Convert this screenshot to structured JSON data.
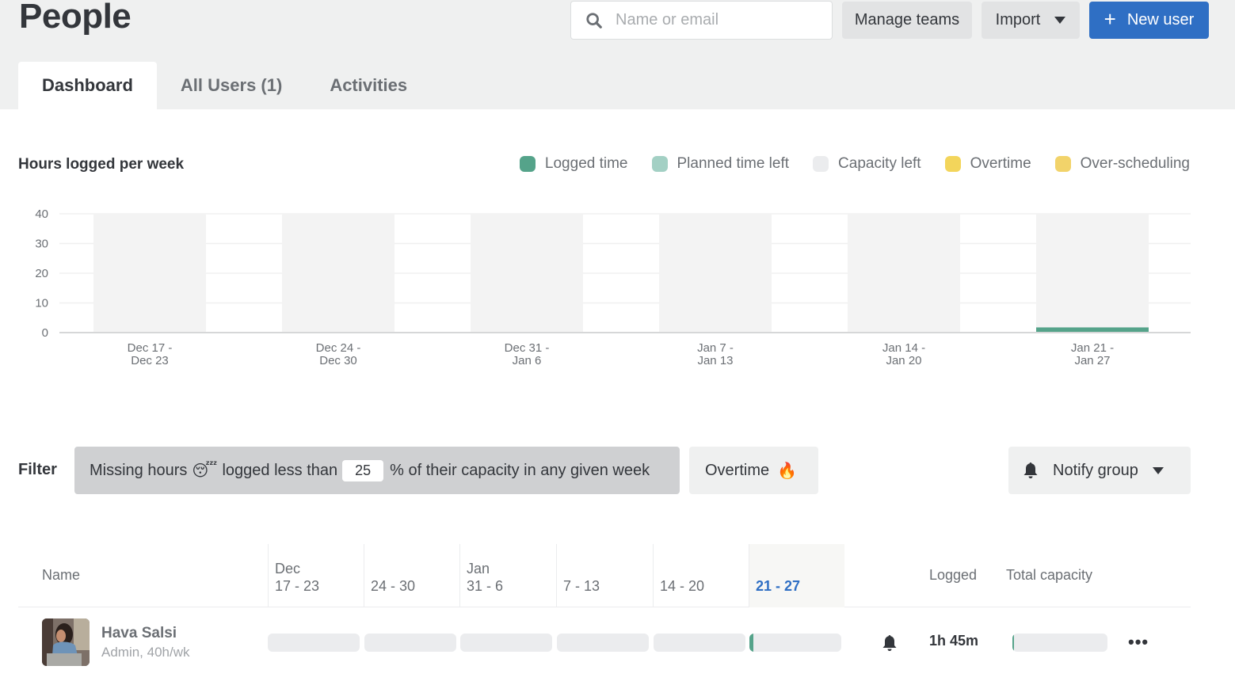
{
  "header": {
    "title": "People",
    "search": {
      "placeholder": "Name or email",
      "value": ""
    },
    "manage_teams_label": "Manage teams",
    "import_label": "Import",
    "new_user_label": "New user"
  },
  "tabs": [
    {
      "label": "Dashboard",
      "active": true
    },
    {
      "label": "All Users (1)",
      "active": false
    },
    {
      "label": "Activities",
      "active": false
    }
  ],
  "legend": [
    {
      "label": "Logged time",
      "color": "#55a38a"
    },
    {
      "label": "Planned time left",
      "color": "#a3d0c4"
    },
    {
      "label": "Capacity left",
      "color": "#ebecee"
    },
    {
      "label": "Overtime",
      "color": "#f3d55b"
    },
    {
      "label": "Over-scheduling",
      "color": "#f2d36a"
    }
  ],
  "chart_data": {
    "type": "bar",
    "title": "Hours logged per week",
    "xlabel": "",
    "ylabel": "",
    "ylim": [
      0,
      40
    ],
    "yticks": [
      0,
      10,
      20,
      30,
      40
    ],
    "grid": true,
    "legend_position": "top-right",
    "categories": [
      [
        "Dec 17 -",
        "Dec 23"
      ],
      [
        "Dec 24 -",
        "Dec 30"
      ],
      [
        "Dec 31 -",
        "Jan 6"
      ],
      [
        "Jan 7 -",
        "Jan 13"
      ],
      [
        "Jan 14 -",
        "Jan 20"
      ],
      [
        "Jan 21 -",
        "Jan 27"
      ]
    ],
    "stacked": true,
    "series": [
      {
        "name": "Logged time",
        "color": "#55a38a",
        "values": [
          0,
          0,
          0,
          0,
          0,
          1.75
        ]
      },
      {
        "name": "Capacity left",
        "color": "#f3f3f3",
        "values": [
          40,
          40,
          40,
          40,
          40,
          38.25
        ]
      }
    ]
  },
  "filter": {
    "label": "Filter",
    "missing_prefix": "Missing hours",
    "missing_emoji": "😴",
    "missing_middle": "logged less than",
    "threshold_value": "25",
    "missing_suffix": "% of their capacity in any given week",
    "overtime_label": "Overtime",
    "overtime_emoji": "🔥",
    "notify_label": "Notify group"
  },
  "table": {
    "name_header": "Name",
    "weeks": [
      {
        "month": "Dec",
        "range": "17 - 23",
        "current": false
      },
      {
        "month": "",
        "range": "24 - 30",
        "current": false
      },
      {
        "month": "Jan",
        "range": "31 - 6",
        "current": false
      },
      {
        "month": "",
        "range": "7 - 13",
        "current": false
      },
      {
        "month": "",
        "range": "14 - 20",
        "current": false
      },
      {
        "month": "",
        "range": "21 - 27",
        "current": true
      }
    ],
    "logged_header": "Logged",
    "capacity_header": "Total capacity",
    "rows": [
      {
        "name": "Hava Salsi",
        "role": "Admin, 40h/wk",
        "week_fill": [
          0,
          0,
          0,
          0,
          0,
          0.044
        ],
        "logged": "1h 45m",
        "capacity_fill": 0.007
      }
    ]
  }
}
